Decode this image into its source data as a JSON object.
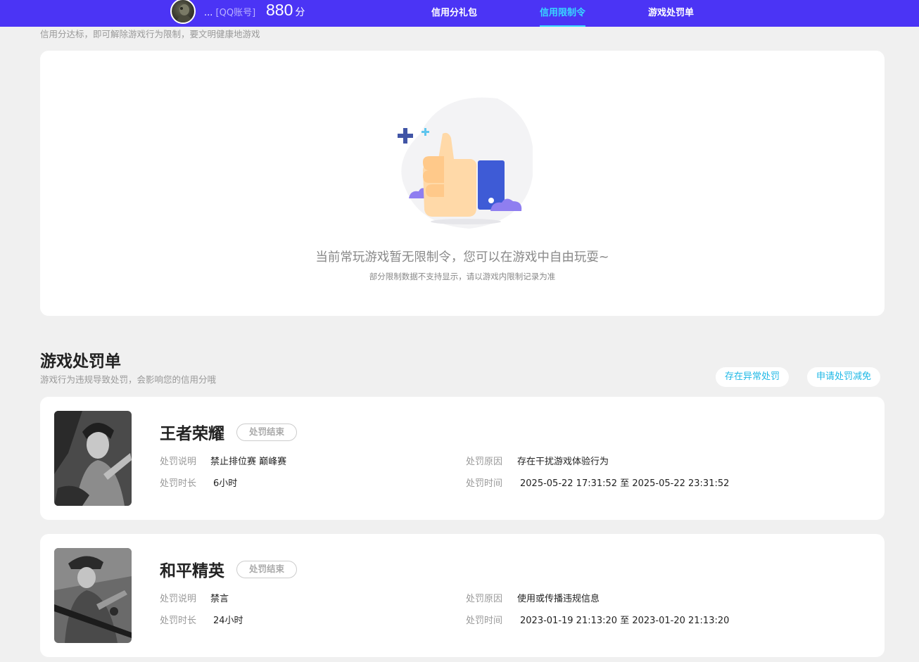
{
  "header": {
    "account_prefix": "...",
    "account_type": "[QQ账号]",
    "score": "880",
    "score_unit": "分",
    "tabs": [
      {
        "label": "信用分礼包",
        "active": false
      },
      {
        "label": "信用限制令",
        "active": true
      },
      {
        "label": "游戏处罚单",
        "active": false
      }
    ],
    "bg_color": "#4b34f5",
    "active_color": "#38d6ff"
  },
  "restriction": {
    "note": "信用分达标，即可解除游戏行为限制，要文明健康地游戏",
    "empty_title": "当前常玩游戏暂无限制令，您可以在游戏中自由玩耍~",
    "empty_sub": "部分限制数据不支持显示，请以游戏内限制记录为准"
  },
  "penalties": {
    "title": "游戏处罚单",
    "subtitle": "游戏行为违规导致处罚，会影响您的信用分哦",
    "abnormal_button": "存在异常处罚",
    "reduce_button": "申请处罚减免",
    "labels": {
      "desc": "处罚说明",
      "duration": "处罚时长",
      "reason": "处罚原因",
      "time": "处罚时间"
    },
    "items": [
      {
        "game": "王者荣耀",
        "status": "处罚结束",
        "desc": "禁止排位赛 巅峰赛",
        "duration": "6小时",
        "reason": "存在干扰游戏体验行为",
        "time": "2025-05-22 17:31:52 至 2025-05-22 23:31:52"
      },
      {
        "game": "和平精英",
        "status": "处罚结束",
        "desc": "禁言",
        "duration": "24小时",
        "reason": "使用或传播违规信息",
        "time": "2023-01-19 21:13:20 至 2023-01-20 21:13:20"
      }
    ]
  }
}
